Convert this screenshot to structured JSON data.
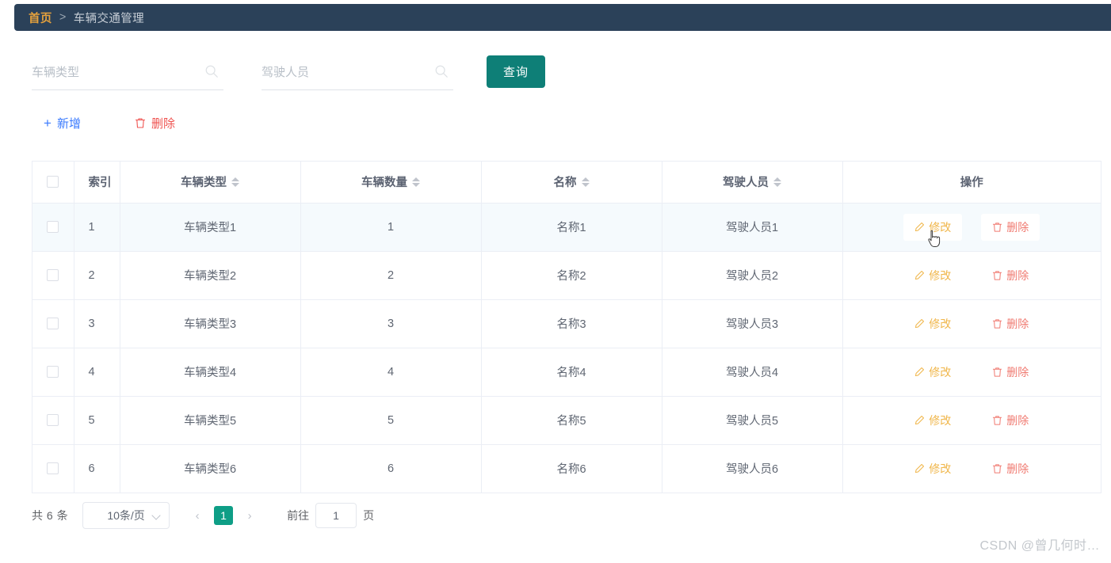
{
  "breadcrumb": {
    "home": "首页",
    "separator": ">",
    "current": "车辆交通管理"
  },
  "search": {
    "vehicle_type": {
      "placeholder": "车辆类型",
      "value": ""
    },
    "driver": {
      "placeholder": "驾驶人员",
      "value": ""
    },
    "query_label": "查询"
  },
  "toolbar": {
    "add_label": "新增",
    "delete_label": "删除",
    "plus": "＋"
  },
  "table": {
    "headers": {
      "index": "索引",
      "vehicle_type": "车辆类型",
      "vehicle_count": "车辆数量",
      "name": "名称",
      "driver": "驾驶人员",
      "operation": "操作"
    },
    "row_ops": {
      "edit": "修改",
      "delete": "删除"
    },
    "rows": [
      {
        "index": "1",
        "vehicle_type": "车辆类型1",
        "vehicle_count": "1",
        "name": "名称1",
        "driver": "驾驶人员1"
      },
      {
        "index": "2",
        "vehicle_type": "车辆类型2",
        "vehicle_count": "2",
        "name": "名称2",
        "driver": "驾驶人员2"
      },
      {
        "index": "3",
        "vehicle_type": "车辆类型3",
        "vehicle_count": "3",
        "name": "名称3",
        "driver": "驾驶人员3"
      },
      {
        "index": "4",
        "vehicle_type": "车辆类型4",
        "vehicle_count": "4",
        "name": "名称4",
        "driver": "驾驶人员4"
      },
      {
        "index": "5",
        "vehicle_type": "车辆类型5",
        "vehicle_count": "5",
        "name": "名称5",
        "driver": "驾驶人员5"
      },
      {
        "index": "6",
        "vehicle_type": "车辆类型6",
        "vehicle_count": "6",
        "name": "名称6",
        "driver": "驾驶人员6"
      }
    ]
  },
  "pagination": {
    "total_label": "共 6 条",
    "page_size": "10条/页",
    "prev": "‹",
    "next": "›",
    "current_page": "1",
    "jump_prefix": "前往",
    "jump_value": "1",
    "jump_suffix": "页"
  },
  "watermark": "CSDN @曾几何时…",
  "colors": {
    "breadcrumb_bg": "#2b4159",
    "breadcrumb_home": "#e6a23c",
    "query_button": "#0e7f77",
    "add_blue": "#3a7afe",
    "delete_red": "#ef5350",
    "edit_orange": "#f0b64a",
    "row_delete": "#f07b72",
    "page_active": "#0e9e86",
    "row_hover": "#f5fafd"
  }
}
